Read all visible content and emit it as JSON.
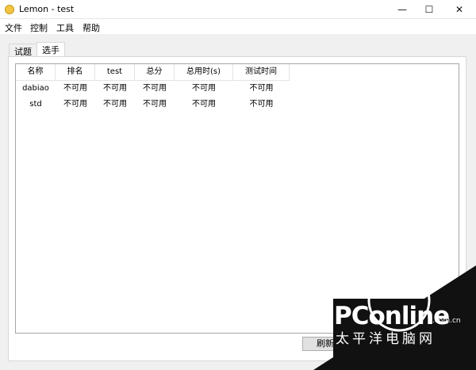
{
  "window": {
    "title": "Lemon - test",
    "minimize_glyph": "—",
    "maximize_glyph": "☐",
    "close_glyph": "✕"
  },
  "menu": [
    {
      "label": "文件"
    },
    {
      "label": "控制"
    },
    {
      "label": "工具"
    },
    {
      "label": "帮助"
    }
  ],
  "tabs": [
    {
      "label": "试题",
      "active": false
    },
    {
      "label": "选手",
      "active": true
    }
  ],
  "table": {
    "headers": [
      "名称",
      "排名",
      "test",
      "总分",
      "总用时(s)",
      "测试时间"
    ],
    "rows": [
      [
        "dabiao",
        "不可用",
        "不可用",
        "不可用",
        "不可用",
        "不可用"
      ],
      [
        "std",
        "不可用",
        "不可用",
        "不可用",
        "不可用",
        "不可用"
      ]
    ]
  },
  "refresh_button": {
    "label": "刷新"
  },
  "watermark": {
    "brand": "PConline",
    "domain": ".com.cn",
    "chinese": "太平洋电脑网"
  },
  "colors": {
    "panel_bg": "#f0f0f0",
    "app_icon": "#f4c542",
    "watermark_dark": "#111111"
  }
}
